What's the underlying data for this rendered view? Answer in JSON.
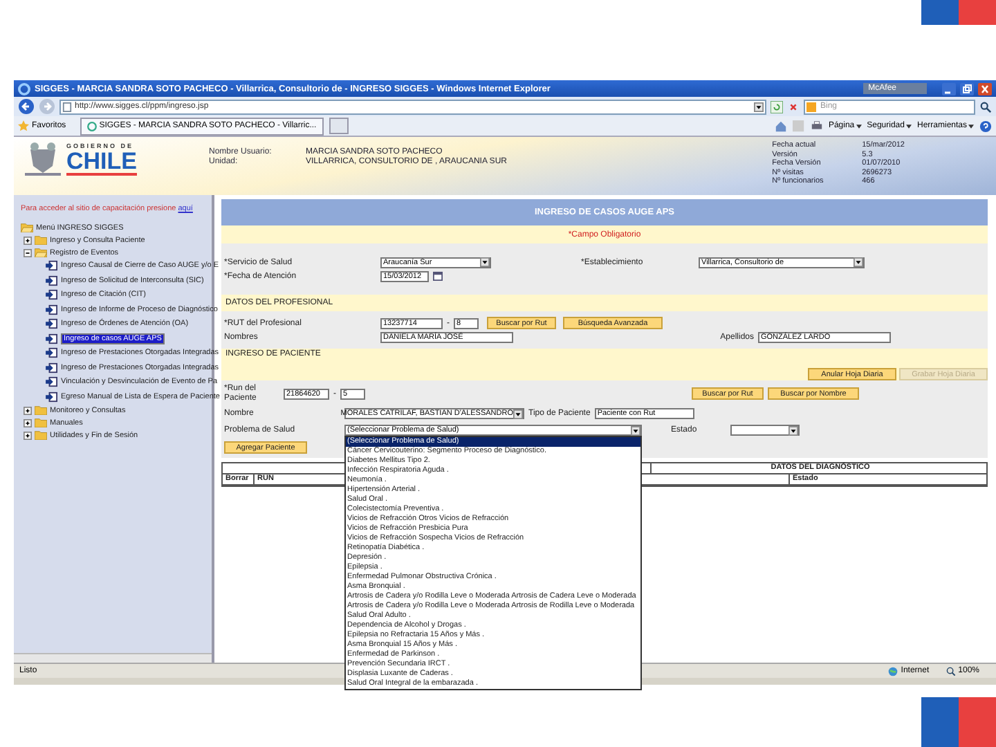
{
  "browser": {
    "title": "SIGGES - MARCIA SANDRA SOTO PACHECO - Villarrica, Consultorio de - INGRESO SIGGES - Windows Internet Explorer",
    "addon": "McAfee",
    "address": "http://www.sigges.cl/ppm/ingreso.jsp",
    "search_placeholder": "Bing",
    "favorites": "Favoritos",
    "tab": "SIGGES - MARCIA SANDRA SOTO PACHECO - Villarric...",
    "command_menus": [
      "Página",
      "Seguridad",
      "Herramientas"
    ]
  },
  "header": {
    "logo_top": "GOBIERNO DE",
    "logo": "CHILE",
    "user": [
      {
        "label": "Nombre Usuario:",
        "value": "MARCIA SANDRA SOTO PACHECO"
      },
      {
        "label": "Unidad:",
        "value": "VILLARRICA, CONSULTORIO DE , ARAUCANIA SUR"
      }
    ],
    "info": [
      {
        "label": "Fecha actual",
        "value": "15/mar/2012"
      },
      {
        "label": "Versión",
        "value": "5.3"
      },
      {
        "label": "Fecha Versión",
        "value": "01/07/2010"
      },
      {
        "label": "Nº visitas",
        "value": "2696273"
      },
      {
        "label": "Nº funcionarios",
        "value": "466"
      }
    ]
  },
  "sidebar": {
    "notice": "Para acceder al sitio de capacitación presione",
    "notice_link": "aquí",
    "menu": {
      "kind": "folder",
      "label": "Menú INGRESO SIGGES",
      "expanded": true,
      "children": [
        {
          "kind": "folder",
          "label": "Ingreso y Consulta Paciente",
          "expanded": false
        },
        {
          "kind": "folder",
          "label": "Registro de Eventos",
          "expanded": true,
          "children": [
            {
              "kind": "page",
              "label": "Ingreso Causal de Cierre de Caso AUGE y/o E",
              "selected": false
            },
            {
              "kind": "page",
              "label": "Ingreso de Solicitud de Interconsulta (SIC)",
              "selected": false
            },
            {
              "kind": "page",
              "label": "Ingreso de Citación (CIT)",
              "selected": false
            },
            {
              "kind": "page",
              "label": "Ingreso de Informe de Proceso de Diagnóstico",
              "selected": false
            },
            {
              "kind": "page",
              "label": "Ingreso de Órdenes de Atención (OA)",
              "selected": false
            },
            {
              "kind": "page",
              "label": "Ingreso de casos AUGE APS",
              "selected": true
            },
            {
              "kind": "page",
              "label": "Ingreso de Prestaciones Otorgadas Integradas",
              "selected": false
            },
            {
              "kind": "page",
              "label": "Ingreso de Prestaciones Otorgadas Integradas",
              "selected": false
            },
            {
              "kind": "page",
              "label": "Vinculación y Desvinculación de Evento de Pa",
              "selected": false
            },
            {
              "kind": "page",
              "label": "Egreso Manual de Lista de Espera de Paciente",
              "selected": false
            }
          ]
        },
        {
          "kind": "folder",
          "label": "Monitoreo y Consultas",
          "expanded": false
        },
        {
          "kind": "folder",
          "label": "Manuales",
          "expanded": false
        },
        {
          "kind": "folder",
          "label": "Utilidades y Fin de Sesión",
          "expanded": false
        }
      ]
    }
  },
  "form": {
    "title": "INGRESO DE CASOS AUGE APS",
    "required_note": "*Campo Obligatorio",
    "service": {
      "label": "*Servicio de Salud",
      "value": "Araucanía Sur"
    },
    "establishment": {
      "label": "*Establecimiento",
      "value": "Villarrica, Consultorio de"
    },
    "date": {
      "label": "*Fecha de Atención",
      "value": "15/03/2012"
    },
    "professional_section": "DATOS DEL PROFESIONAL",
    "rut": {
      "label": "*RUT del Profesional",
      "value": "13237714",
      "separator": "-",
      "check_digit": "8"
    },
    "professional_buttons": [
      "Buscar por Rut",
      "Búsqueda Avanzada"
    ],
    "names": {
      "label": "Nombres",
      "value": "DANIELA MARÍA JOSÉ"
    },
    "surnames": {
      "label": "Apellidos",
      "value": "GONZÁLEZ LARDO"
    },
    "patient_section": "INGRESO DE PACIENTE",
    "sheet_buttons": [
      {
        "label": "Anular Hoja Diaria",
        "disabled": false
      },
      {
        "label": "Grabar Hoja Diaria",
        "disabled": true
      }
    ],
    "patient_run": {
      "label": "*Run del Paciente",
      "value": "21864620",
      "separator": "-",
      "check_digit": "5"
    },
    "patient_buttons": [
      "Buscar por Rut",
      "Buscar por Nombre"
    ],
    "patient_name": {
      "label": "Nombre",
      "value": "MORALES CATRILAF, BASTIAN D'ALESSANDRO"
    },
    "patient_type": {
      "label": "Tipo de Paciente",
      "value": "Paciente con Rut"
    },
    "health_problem": {
      "label": "Problema de Salud",
      "value": "(Seleccionar Problema de Salud)",
      "expanded": true,
      "options": [
        {
          "label": "(Seleccionar Problema de Salud)",
          "selected": true
        },
        {
          "label": "Cáncer Cervicouterino: Segmento Proceso de Diagnóstico.",
          "selected": false
        },
        {
          "label": "Diabetes Mellitus Tipo 2.",
          "selected": false
        },
        {
          "label": "Infección Respiratoria Aguda .",
          "selected": false
        },
        {
          "label": "Neumonía .",
          "selected": false
        },
        {
          "label": "Hipertensión Arterial .",
          "selected": false
        },
        {
          "label": "Salud Oral .",
          "selected": false
        },
        {
          "label": "Colecistectomía Preventiva .",
          "selected": false
        },
        {
          "label": "Vicios de Refracción Otros Vicios de Refracción",
          "selected": false
        },
        {
          "label": "Vicios de Refracción Presbicia Pura",
          "selected": false
        },
        {
          "label": "Vicios de Refracción Sospecha Vicios de Refracción",
          "selected": false
        },
        {
          "label": "Retinopatía Diabética .",
          "selected": false
        },
        {
          "label": "Depresión .",
          "selected": false
        },
        {
          "label": "Epilepsia .",
          "selected": false
        },
        {
          "label": "Enfermedad Pulmonar Obstructiva Crónica .",
          "selected": false
        },
        {
          "label": "Asma Bronquial .",
          "selected": false
        },
        {
          "label": "Artrosis de Cadera y/o Rodilla Leve o Moderada Artrosis de Cadera Leve o Moderada",
          "selected": false
        },
        {
          "label": "Artrosis de Cadera y/o Rodilla Leve o Moderada Artrosis de Rodilla Leve o Moderada",
          "selected": false
        },
        {
          "label": "Salud Oral Adulto .",
          "selected": false
        },
        {
          "label": "Dependencia de Alcohol y Drogas .",
          "selected": false
        },
        {
          "label": "Epilepsia no Refractaria 15 Años y Más .",
          "selected": false
        },
        {
          "label": "Asma Bronquial 15 Años y Más .",
          "selected": false
        },
        {
          "label": "Enfermedad de Parkinson .",
          "selected": false
        },
        {
          "label": "Prevención Secundaria IRCT .",
          "selected": false
        },
        {
          "label": "Displasia Luxante de Caderas .",
          "selected": false
        },
        {
          "label": "Salud Oral Integral de la embarazada .",
          "selected": false
        }
      ]
    },
    "status": {
      "label": "Estado"
    },
    "add_button": "Agregar Paciente",
    "table": {
      "group_heading": "DATOS DEL DIAGNÓSTICO",
      "columns": [
        "Borrar",
        "RUN",
        "Estado"
      ]
    }
  },
  "status_bar": {
    "text": "Listo",
    "zone": "Internet",
    "zoom": "100%"
  }
}
